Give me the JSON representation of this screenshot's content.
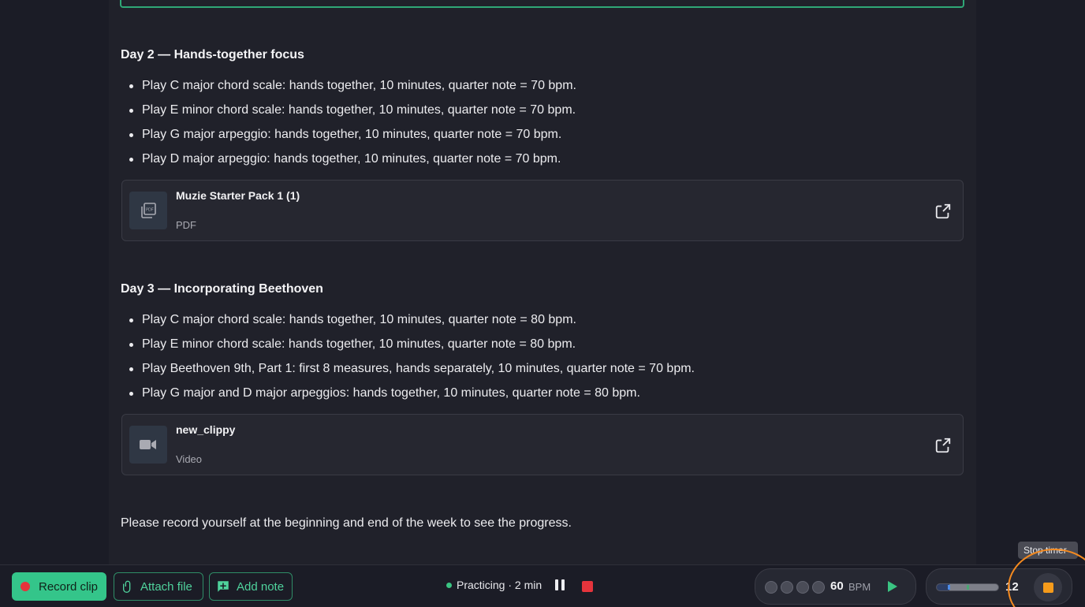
{
  "day2": {
    "title": "Day 2 — Hands-together focus",
    "tasks": [
      "Play C major chord scale: hands together, 10 minutes, quarter note = 70 bpm.",
      "Play E minor chord scale: hands together, 10 minutes, quarter note = 70 bpm.",
      "Play G major arpeggio: hands together, 10 minutes, quarter note = 70 bpm.",
      "Play D major arpeggio: hands together, 10 minutes, quarter note = 70 bpm."
    ],
    "attachment": {
      "name": "Muzie Starter Pack 1 (1)",
      "type": "PDF",
      "icon": "pdf-icon"
    }
  },
  "day3": {
    "title": "Day 3 — Incorporating Beethoven",
    "tasks": [
      "Play C major chord scale: hands together, 10 minutes, quarter note = 80 bpm.",
      "Play E minor chord scale: hands together, 10 minutes, quarter note = 80 bpm.",
      "Play Beethoven 9th, Part 1: first 8 measures, hands separately, 10 minutes, quarter note = 70 bpm.",
      "Play G major and D major arpeggios: hands together, 10 minutes, quarter note = 80 bpm."
    ],
    "attachment": {
      "name": "new_clippy",
      "type": "Video",
      "icon": "video-camera-icon"
    }
  },
  "closing_text": "Please record yourself at the beginning and end of the week to see the progress.",
  "toolbar": {
    "record_label": "Record clip",
    "attach_label": "Attach file",
    "note_label": "Add note",
    "practice_status": "Practicing · 2 min",
    "metronome": {
      "bpm": "60",
      "unit": "BPM",
      "beats": 4
    },
    "timer": {
      "value": "12",
      "progress": 0.2
    },
    "stop_timer_tooltip": "Stop timer"
  },
  "colors": {
    "accent_green": "#34c58a",
    "record_red": "#e5343c",
    "stop_orange": "#f59b1b",
    "highlight_ring": "#f58a1f"
  }
}
